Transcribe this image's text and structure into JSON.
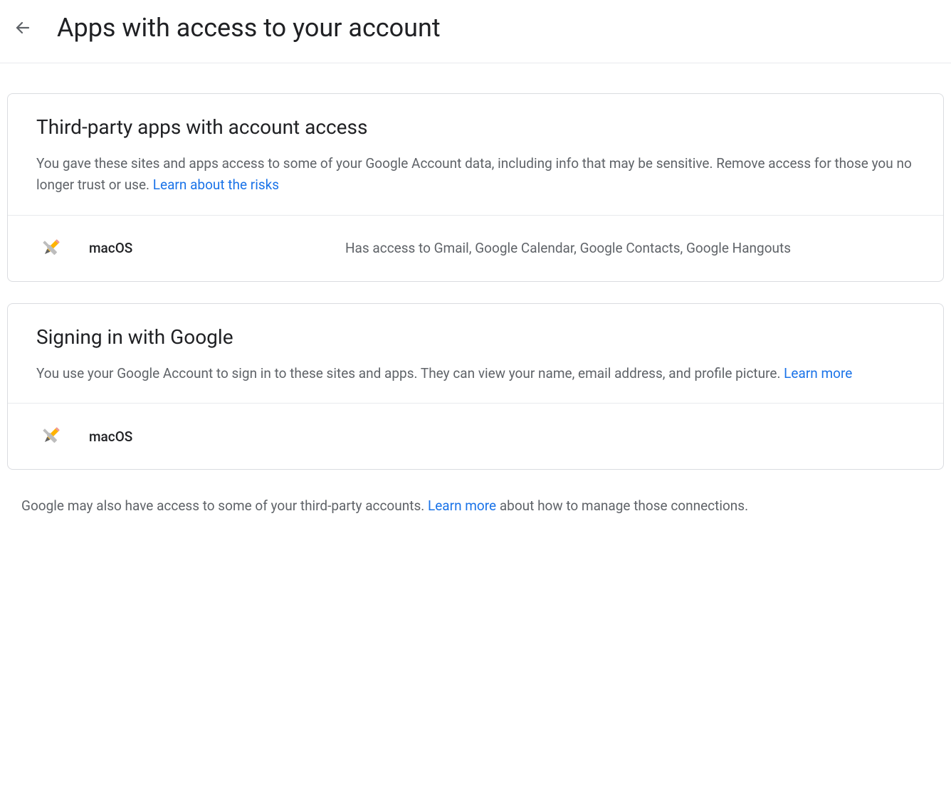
{
  "header": {
    "title": "Apps with access to your account"
  },
  "sections": {
    "thirdParty": {
      "title": "Third-party apps with account access",
      "desc_pre": "You gave these sites and apps access to some of your Google Account data, including info that may be sensitive. Remove access for those you no longer trust or use. ",
      "link": "Learn about the risks",
      "apps": [
        {
          "name": "macOS",
          "access": "Has access to Gmail, Google Calendar, Google Contacts, Google Hangouts"
        }
      ]
    },
    "signIn": {
      "title": "Signing in with Google",
      "desc_pre": "You use your Google Account to sign in to these sites and apps. They can view your name, email address, and profile picture. ",
      "link": "Learn more",
      "apps": [
        {
          "name": "macOS"
        }
      ]
    }
  },
  "footer": {
    "text_pre": "Google may also have access to some of your third-party accounts. ",
    "link": "Learn more",
    "text_post": " about how to manage those connections."
  }
}
